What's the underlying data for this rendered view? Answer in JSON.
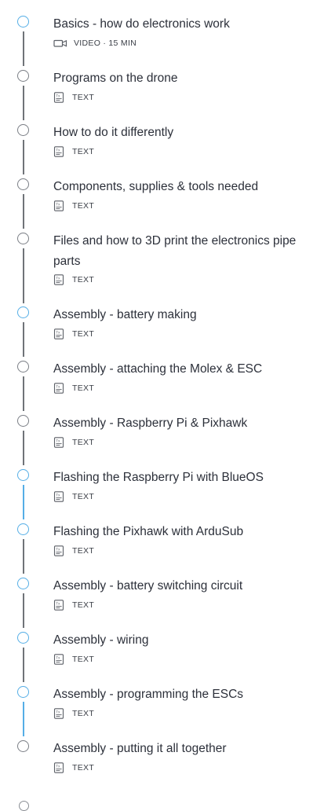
{
  "lessons": [
    {
      "title": "Basics - how do electronics work",
      "type": "video",
      "meta": "VIDEO · 15 MIN",
      "node": "blue",
      "line": "gray",
      "icon": "video-camera-icon"
    },
    {
      "title": "Programs on the drone",
      "type": "text",
      "meta": "TEXT",
      "node": "gray",
      "line": "gray",
      "icon": "text-document-icon"
    },
    {
      "title": "How to do it differently",
      "type": "text",
      "meta": "TEXT",
      "node": "gray",
      "line": "gray",
      "icon": "text-document-icon"
    },
    {
      "title": "Components, supplies & tools needed",
      "type": "text",
      "meta": "TEXT",
      "node": "gray",
      "line": "gray",
      "icon": "text-document-icon"
    },
    {
      "title": "Files and how to 3D print the electronics pipe parts",
      "type": "text",
      "meta": "TEXT",
      "node": "gray",
      "line": "gray",
      "icon": "text-document-icon"
    },
    {
      "title": "Assembly - battery making",
      "type": "text",
      "meta": "TEXT",
      "node": "blue",
      "line": "gray",
      "icon": "text-document-icon"
    },
    {
      "title": "Assembly - attaching the Molex & ESC",
      "type": "text",
      "meta": "TEXT",
      "node": "gray",
      "line": "gray",
      "icon": "text-document-icon"
    },
    {
      "title": "Assembly - Raspberry Pi & Pixhawk",
      "type": "text",
      "meta": "TEXT",
      "node": "gray",
      "line": "gray",
      "icon": "text-document-icon"
    },
    {
      "title": "Flashing the Raspberry Pi with BlueOS",
      "type": "text",
      "meta": "TEXT",
      "node": "blue",
      "line": "blue",
      "icon": "text-document-icon"
    },
    {
      "title": "Flashing the Pixhawk with ArduSub",
      "type": "text",
      "meta": "TEXT",
      "node": "blue",
      "line": "gray",
      "icon": "text-document-icon"
    },
    {
      "title": "Assembly - battery switching circuit",
      "type": "text",
      "meta": "TEXT",
      "node": "blue",
      "line": "gray",
      "icon": "text-document-icon"
    },
    {
      "title": "Assembly - wiring",
      "type": "text",
      "meta": "TEXT",
      "node": "blue",
      "line": "gray",
      "icon": "text-document-icon"
    },
    {
      "title": "Assembly - programming the ESCs",
      "type": "text",
      "meta": "TEXT",
      "node": "blue",
      "line": "blue",
      "icon": "text-document-icon"
    },
    {
      "title": "Assembly - putting it all together",
      "type": "text",
      "meta": "TEXT",
      "node": "gray",
      "line": "none",
      "icon": "text-document-icon"
    }
  ],
  "colors": {
    "node_blue": "#55aee6",
    "node_gray": "#7a7e85",
    "line_gray": "#6f7378",
    "text": "#2c303a"
  }
}
